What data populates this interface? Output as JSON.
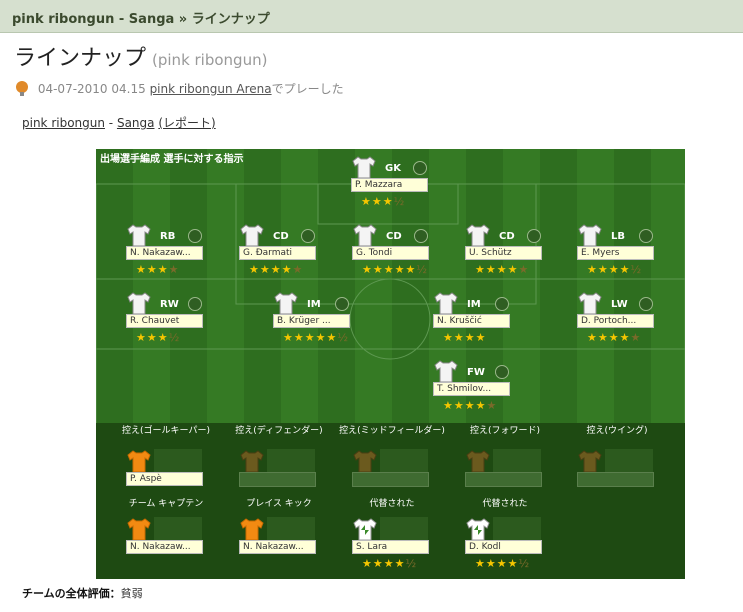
{
  "title": "pink ribongun - Sanga » ラインナップ",
  "heading": "ラインナップ",
  "heading_sub": "(pink ribongun)",
  "meta": {
    "date": "04-07-2010 04.15",
    "arena": "pink ribongun Arena",
    "suffix": "でプレーした"
  },
  "links": {
    "home": "pink ribongun",
    "sep": " - ",
    "away": "Sanga",
    "report": "(レポート)"
  },
  "pitch_header": "出場選手編成  選手に対する指示",
  "players": [
    {
      "pos": "GK",
      "name": "P. Mazzara",
      "stars": "★★★",
      "half": "½"
    },
    {
      "pos": "RB",
      "name": "N. Nakazaw...",
      "stars": "★★★",
      "half": "★"
    },
    {
      "pos": "CD",
      "name": "G. Đarmati",
      "stars": "★★★★",
      "half": "★"
    },
    {
      "pos": "CD",
      "name": "G. Tondi",
      "stars": "★★★★★",
      "half": "½"
    },
    {
      "pos": "CD",
      "name": "U. Schütz",
      "stars": "★★★★",
      "half": "★"
    },
    {
      "pos": "LB",
      "name": "E. Myers",
      "stars": "★★★★",
      "half": "½"
    },
    {
      "pos": "RW",
      "name": "R. Chauvet",
      "stars": "★★★",
      "half": "½"
    },
    {
      "pos": "IM",
      "name": "B. Krüger ...",
      "stars": "★★★★★",
      "half": "½"
    },
    {
      "pos": "IM",
      "name": "N. Kruščić",
      "stars": "★★★★",
      "half": ""
    },
    {
      "pos": "LW",
      "name": "D. Portoch...",
      "stars": "★★★★",
      "half": "★"
    },
    {
      "pos": "FW",
      "name": "T. Shmilov...",
      "stars": "★★★★",
      "half": "★"
    }
  ],
  "bench": [
    {
      "label": "控え(ゴールキーパー)",
      "name": "P. Aspè",
      "type": "orange"
    },
    {
      "label": "控え(ディフェンダー)",
      "name": "",
      "type": "empty"
    },
    {
      "label": "控え(ミッドフィールダー)",
      "name": "",
      "type": "empty"
    },
    {
      "label": "控え(フォワード)",
      "name": "",
      "type": "empty"
    },
    {
      "label": "控え(ウイング)",
      "name": "",
      "type": "empty"
    }
  ],
  "specials": [
    {
      "label": "チーム キャプテン",
      "name": "N. Nakazaw...",
      "type": "orange",
      "stars": ""
    },
    {
      "label": "プレイス キック",
      "name": "N. Nakazaw...",
      "type": "orange",
      "stars": ""
    },
    {
      "label": "代替された",
      "name": "S. Lara",
      "type": "sub",
      "stars": "★★★★",
      "half": "½"
    },
    {
      "label": "代替された",
      "name": "D. Kodl",
      "type": "sub",
      "stars": "★★★★",
      "half": "½"
    }
  ],
  "rating": {
    "label": "チームの全体評価：",
    "value": "貧弱"
  },
  "colors": {
    "pitch": "#357a24",
    "accent": "#3b4a2e",
    "star": "#f6c600"
  }
}
